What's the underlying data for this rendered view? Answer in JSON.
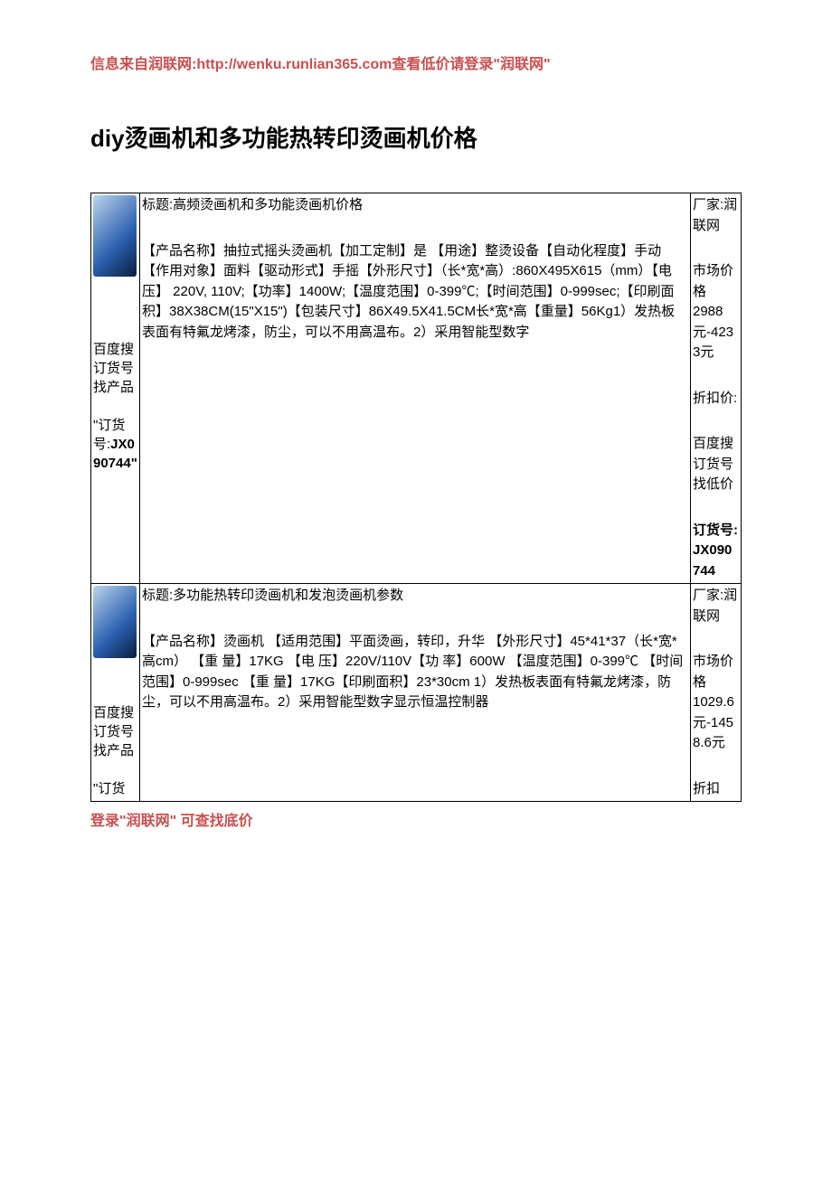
{
  "header_note": "信息来自润联网:http://wenku.runlian365.com查看低价请登录\"润联网\"",
  "page_title": "diy烫画机和多功能热转印烫画机价格",
  "footer_note": "登录\"润联网\" 可查找底价",
  "products": [
    {
      "thumb": {
        "search_label": "百度搜订货号找产品",
        "order_prefix": "\"订货号:",
        "order_code": "JX090744\""
      },
      "desc": {
        "title": "标题:高频烫画机和多功能烫画机价格",
        "body": "【产品名称】抽拉式摇头烫画机【加工定制】是\n【用途】整烫设备【自动化程度】手动【作用对象】面料【驱动形式】手摇【外形尺寸】（长*宽*高）:860X495X615（mm）【电压】 220V,\n110V;【功率】1400W;【温度范围】0-399℃;【时间范围】0-999sec;【印刷面积】38X38CM(15\"X15\")【包装尺寸】86X49.5X41.5CM长*宽*高【重量】56Kg1）发热板表面有特氟龙烤漆，防尘，可以不用高温布。2）采用智能型数字"
      },
      "meta": {
        "vendor_label": "厂家:润联网",
        "price_label": "市场价格",
        "price_value": "2988元-4233元",
        "discount_label": "折扣价:",
        "search_low": "百度搜订货号找低价",
        "order_label": "订货号:JX090744"
      }
    },
    {
      "thumb": {
        "search_label": "百度搜订货号找产品",
        "order_prefix": "\"订货"
      },
      "desc": {
        "title": "标题:多功能热转印烫画机和发泡烫画机参数",
        "body": "【产品名称】烫画机 【适用范围】平面烫画，转印，升华\n【外形尺寸】45*41*37（长*宽*高cm） 【重 量】17KG 【电 压】220V/110V【功 率】600W 【温度范围】0-399℃ 【时间范围】0-999sec 【重 量】17KG【印刷面积】23*30cm 1）发热板表面有特氟龙烤漆，防尘，可以不用高温布。2）采用智能型数字显示恒温控制器"
      },
      "meta": {
        "vendor_label": "厂家:润联网",
        "price_label": "市场价格",
        "price_value": "1029.6元-1458.6元",
        "discount_label": "折扣"
      }
    }
  ]
}
